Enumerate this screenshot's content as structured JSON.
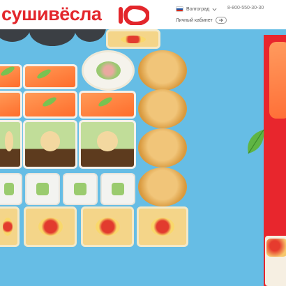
{
  "brand": {
    "name": "сушивёсла",
    "logo_mark": "10",
    "accent": "#e3262b"
  },
  "header": {
    "city": "Волгоград",
    "phone": "8-800-550-30-30",
    "cabinet_label": "Личный кабинет",
    "flag_colors": [
      "#ffffff",
      "#1c57a7",
      "#d52b1e"
    ]
  },
  "hero": {
    "background": "#66bde5",
    "side_panel_color": "#e8262d"
  },
  "icons": {
    "region_flag": "russia-flag-icon",
    "region_dropdown": "chevron-down-icon",
    "cabinet": "login-arrow-icon"
  }
}
